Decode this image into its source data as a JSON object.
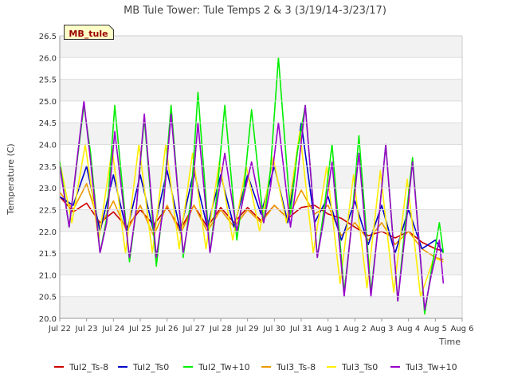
{
  "chart_data": {
    "type": "line",
    "title": "MB Tule Tower: Tule Temps 2 & 3 (3/19/14-3/23/17)",
    "xlabel": "Time",
    "ylabel": "Temperature (C)",
    "site_label": "MB_tule",
    "xlim": [
      0,
      15
    ],
    "ylim": [
      20.0,
      26.5
    ],
    "x_ticks": [
      {
        "value": 0,
        "label": "Jul 22"
      },
      {
        "value": 1,
        "label": "Jul 23"
      },
      {
        "value": 2,
        "label": "Jul 24"
      },
      {
        "value": 3,
        "label": "Jul 25"
      },
      {
        "value": 4,
        "label": "Jul 26"
      },
      {
        "value": 5,
        "label": "Jul 27"
      },
      {
        "value": 6,
        "label": "Jul 28"
      },
      {
        "value": 7,
        "label": "Jul 29"
      },
      {
        "value": 8,
        "label": "Jul 30"
      },
      {
        "value": 9,
        "label": "Jul 31"
      },
      {
        "value": 10,
        "label": "Aug 1"
      },
      {
        "value": 11,
        "label": "Aug 2"
      },
      {
        "value": 12,
        "label": "Aug 3"
      },
      {
        "value": 13,
        "label": "Aug 4"
      },
      {
        "value": 14,
        "label": "Aug 5"
      },
      {
        "value": 15,
        "label": "Aug 6"
      }
    ],
    "y_ticks": [
      20.0,
      20.5,
      21.0,
      21.5,
      22.0,
      22.5,
      23.0,
      23.5,
      24.0,
      24.5,
      25.0,
      25.5,
      26.0,
      26.5
    ],
    "y_tick_labels": [
      "20.0",
      "20.5",
      "21.0",
      "21.5",
      "22.0",
      "22.5",
      "23.0",
      "23.5",
      "24.0",
      "24.5",
      "25.0",
      "25.5",
      "26.0",
      "26.5"
    ],
    "grid": "horizontal alternating bands",
    "legend_position": "bottom",
    "series": [
      {
        "name": "Tul2_Ts-8",
        "color": "#cc0000",
        "x": [
          0.0,
          0.5,
          1.0,
          1.5,
          2.0,
          2.5,
          3.0,
          3.5,
          4.0,
          4.5,
          5.0,
          5.5,
          6.0,
          6.5,
          7.0,
          7.5,
          8.0,
          8.5,
          9.0,
          9.5,
          10.0,
          10.5,
          11.0,
          11.5,
          12.0,
          12.5,
          13.0,
          13.5,
          14.0,
          14.3
        ],
        "y": [
          22.8,
          22.45,
          22.65,
          22.2,
          22.45,
          22.1,
          22.5,
          22.15,
          22.55,
          22.05,
          22.6,
          22.1,
          22.55,
          22.2,
          22.55,
          22.25,
          22.6,
          22.3,
          22.55,
          22.6,
          22.4,
          22.3,
          22.1,
          21.9,
          22.0,
          21.85,
          22.0,
          21.75,
          21.6,
          21.55
        ]
      },
      {
        "name": "Tul2_Ts0",
        "color": "#0000cc",
        "x": [
          0.0,
          0.5,
          1.0,
          1.5,
          2.0,
          2.5,
          3.0,
          3.5,
          4.0,
          4.5,
          5.0,
          5.5,
          6.0,
          6.5,
          7.0,
          7.5,
          8.0,
          8.5,
          9.0,
          9.5,
          10.0,
          10.5,
          11.0,
          11.5,
          12.0,
          12.5,
          13.0,
          13.5,
          14.0,
          14.3
        ],
        "y": [
          22.8,
          22.6,
          23.5,
          22.0,
          23.3,
          22.0,
          23.3,
          22.0,
          23.4,
          22.0,
          23.4,
          22.1,
          23.3,
          22.1,
          23.3,
          22.4,
          23.5,
          22.2,
          24.5,
          22.2,
          22.8,
          21.8,
          22.7,
          21.7,
          22.6,
          21.5,
          22.5,
          21.6,
          21.8,
          21.5
        ]
      },
      {
        "name": "Tul2_Tw+10",
        "color": "#00ee00",
        "x": [
          0.0,
          0.35,
          0.9,
          1.15,
          1.5,
          1.75,
          2.05,
          2.6,
          2.85,
          3.15,
          3.6,
          3.85,
          4.15,
          4.6,
          4.9,
          5.15,
          5.6,
          5.85,
          6.15,
          6.6,
          6.85,
          7.15,
          7.6,
          7.85,
          8.15,
          8.6,
          8.85,
          9.15,
          9.6,
          9.85,
          10.15,
          10.6,
          10.85,
          11.15,
          11.6,
          11.85,
          12.15,
          12.6,
          12.85,
          13.15,
          13.6,
          13.85,
          14.15,
          14.3
        ],
        "y": [
          23.6,
          22.1,
          24.9,
          23.8,
          21.5,
          22.3,
          24.9,
          21.3,
          22.5,
          24.6,
          21.2,
          22.6,
          24.9,
          21.4,
          22.8,
          25.2,
          21.5,
          22.8,
          24.9,
          21.8,
          22.9,
          24.8,
          22.2,
          23.4,
          26.0,
          22.4,
          23.8,
          24.9,
          21.4,
          22.5,
          24.0,
          20.6,
          22.0,
          24.2,
          20.6,
          22.0,
          24.0,
          20.4,
          22.0,
          23.7,
          20.1,
          21.1,
          22.2,
          21.5
        ]
      },
      {
        "name": "Tul3_Ts-8",
        "color": "#ee9900",
        "x": [
          0.0,
          0.5,
          1.0,
          1.5,
          2.0,
          2.5,
          3.0,
          3.5,
          4.0,
          4.5,
          5.0,
          5.5,
          6.0,
          6.5,
          7.0,
          7.5,
          8.0,
          8.5,
          9.0,
          9.5,
          10.0,
          10.5,
          11.0,
          11.5,
          12.0,
          12.5,
          13.0,
          13.5,
          14.0,
          14.3
        ],
        "y": [
          22.9,
          22.5,
          23.1,
          22.1,
          22.7,
          22.0,
          22.6,
          21.9,
          22.6,
          21.95,
          22.6,
          22.0,
          22.5,
          22.1,
          22.5,
          22.2,
          22.6,
          22.3,
          22.95,
          22.4,
          22.6,
          21.9,
          22.2,
          21.8,
          22.2,
          21.7,
          22.0,
          21.6,
          21.4,
          21.35
        ]
      },
      {
        "name": "Tul3_Ts0",
        "color": "#ffee00",
        "x": [
          0.0,
          0.45,
          0.95,
          1.45,
          1.95,
          2.45,
          2.95,
          3.45,
          3.95,
          4.45,
          4.95,
          5.45,
          5.95,
          6.45,
          6.95,
          7.45,
          7.95,
          8.45,
          8.95,
          9.45,
          9.95,
          10.45,
          10.95,
          11.45,
          11.95,
          12.45,
          12.95,
          13.45,
          13.95,
          14.3
        ],
        "y": [
          23.6,
          22.2,
          24.0,
          21.8,
          23.9,
          21.5,
          24.0,
          21.5,
          24.0,
          21.6,
          23.8,
          21.6,
          23.6,
          21.8,
          23.5,
          22.0,
          23.7,
          22.2,
          24.3,
          21.5,
          23.5,
          20.8,
          23.3,
          20.7,
          23.4,
          20.6,
          23.2,
          20.5,
          21.4,
          21.3
        ]
      },
      {
        "name": "Tul3_Tw+10",
        "color": "#9900cc",
        "x": [
          0.0,
          0.35,
          0.9,
          1.15,
          1.5,
          1.75,
          2.05,
          2.6,
          2.85,
          3.15,
          3.6,
          3.85,
          4.15,
          4.6,
          4.9,
          5.15,
          5.6,
          5.85,
          6.15,
          6.6,
          6.85,
          7.15,
          7.6,
          7.85,
          8.15,
          8.6,
          8.85,
          9.15,
          9.6,
          9.85,
          10.15,
          10.6,
          10.85,
          11.15,
          11.6,
          11.85,
          12.15,
          12.6,
          12.85,
          13.15,
          13.6,
          13.85,
          14.15,
          14.3
        ],
        "y": [
          23.5,
          22.1,
          25.0,
          23.6,
          21.5,
          22.2,
          24.3,
          21.4,
          22.5,
          24.7,
          21.4,
          22.5,
          24.7,
          21.5,
          22.6,
          24.5,
          21.5,
          22.6,
          23.8,
          22.0,
          22.8,
          23.6,
          22.2,
          23.0,
          24.5,
          22.1,
          23.2,
          24.9,
          21.4,
          22.3,
          23.6,
          20.5,
          22.0,
          23.8,
          20.5,
          22.0,
          24.0,
          20.4,
          21.8,
          23.6,
          20.2,
          21.0,
          21.8,
          20.8
        ]
      }
    ]
  }
}
